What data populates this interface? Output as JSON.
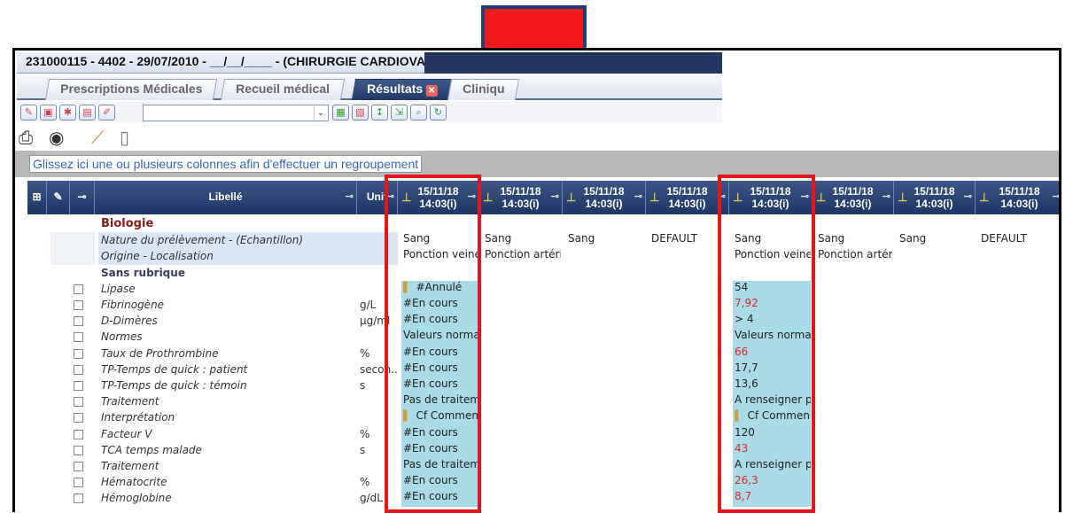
{
  "window": {
    "title": "231000115 - 4402 - 29/07/2010 - __/__/____ - (CHIRURGIE CARDIOVA"
  },
  "tabs": [
    {
      "label": "Prescriptions Médicales",
      "active": false
    },
    {
      "label": "Recueil médical",
      "active": false
    },
    {
      "label": "Résultats",
      "active": true
    },
    {
      "label": "Cliniqu",
      "active": false
    }
  ],
  "toolbar": {
    "combo_value": ""
  },
  "grouping_hint": "Glissez ici une ou plusieurs colonnes afin d'effectuer un regroupement",
  "headers": {
    "libelle": "Libellé",
    "unit": "Unit",
    "columns": [
      {
        "date": "15/11/18",
        "time": "14:03(i)"
      },
      {
        "date": "15/11/18",
        "time": "14:03(i)"
      },
      {
        "date": "15/11/18",
        "time": "14:03(i)"
      },
      {
        "date": "15/11/18",
        "time": "14:03(i)"
      },
      {
        "date": "15/11/18",
        "time": "14:03(i)"
      },
      {
        "date": "15/11/18",
        "time": "14:03(i)"
      },
      {
        "date": "15/11/18",
        "time": "14:03(i)"
      },
      {
        "date": "15/11/18",
        "time": "14:03(i)"
      }
    ]
  },
  "rows": [
    {
      "label": "Biologie",
      "unit": "",
      "type": "biol",
      "values": [
        "",
        "",
        "",
        "",
        "",
        "",
        "",
        ""
      ]
    },
    {
      "label": "Nature du prélèvement - (Echantillon)",
      "unit": "",
      "type": "blue",
      "values": [
        "Sang",
        "Sang",
        "Sang",
        "DEFAULT",
        "Sang",
        "Sang",
        "Sang",
        "DEFAULT"
      ]
    },
    {
      "label": "Origine - Localisation",
      "unit": "",
      "type": "blue",
      "values": [
        "Ponction veine...",
        "Ponction artéri...",
        "",
        "",
        "Ponction veine...",
        "Ponction artéri...",
        "",
        ""
      ]
    },
    {
      "label": "Sans rubrique",
      "unit": "",
      "type": "sect",
      "values": [
        "",
        "",
        "",
        "",
        "",
        "",
        "",
        ""
      ]
    },
    {
      "label": "Lipase",
      "unit": "",
      "type": "item",
      "values": [
        "#Annulé",
        "",
        "",
        "",
        "54",
        "",
        "",
        ""
      ],
      "pen": [
        true,
        false
      ]
    },
    {
      "label": "Fibrinogène",
      "unit": "g/L",
      "type": "item",
      "values": [
        "#En cours",
        "",
        "",
        "",
        "7,92",
        "",
        "",
        ""
      ],
      "red5": true
    },
    {
      "label": "D-Dimères",
      "unit": "µg/ml",
      "type": "item",
      "values": [
        "#En cours",
        "",
        "",
        "",
        "> 4",
        "",
        "",
        ""
      ]
    },
    {
      "label": "Normes",
      "unit": "",
      "type": "item",
      "values": [
        "Valeurs norma...",
        "",
        "",
        "",
        "Valeurs norma...",
        "",
        "",
        ""
      ]
    },
    {
      "label": "Taux de Prothrombine",
      "unit": "%",
      "type": "item",
      "values": [
        "#En cours",
        "",
        "",
        "",
        "66",
        "",
        "",
        ""
      ],
      "red5": true
    },
    {
      "label": "TP-Temps de quick : patient",
      "unit": "secon...",
      "type": "item",
      "values": [
        "#En cours",
        "",
        "",
        "",
        "17,7",
        "",
        "",
        ""
      ]
    },
    {
      "label": "TP-Temps de quick : témoin",
      "unit": "s",
      "type": "item",
      "values": [
        "#En cours",
        "",
        "",
        "",
        "13,6",
        "",
        "",
        ""
      ]
    },
    {
      "label": "Traitement",
      "unit": "",
      "type": "item",
      "values": [
        "Pas de traitem...",
        "",
        "",
        "",
        "A renseigner p...",
        "",
        "",
        ""
      ]
    },
    {
      "label": "Interprétation",
      "unit": "",
      "type": "item",
      "values": [
        "Cf Commen...",
        "",
        "",
        "",
        "Cf Commen...",
        "",
        "",
        ""
      ],
      "pen": [
        true,
        true
      ]
    },
    {
      "label": "Facteur V",
      "unit": "%",
      "type": "item",
      "values": [
        "#En cours",
        "",
        "",
        "",
        "120",
        "",
        "",
        ""
      ]
    },
    {
      "label": "TCA temps malade",
      "unit": "s",
      "type": "item",
      "values": [
        "#En cours",
        "",
        "",
        "",
        "43",
        "",
        "",
        ""
      ],
      "red5": true
    },
    {
      "label": "Traitement",
      "unit": "",
      "type": "item",
      "values": [
        "Pas de traitem...",
        "",
        "",
        "",
        "A renseigner p...",
        "",
        "",
        ""
      ]
    },
    {
      "label": "Hématocrite",
      "unit": "%",
      "type": "item",
      "values": [
        "#En cours",
        "",
        "",
        "",
        "26,3",
        "",
        "",
        ""
      ],
      "red5": true
    },
    {
      "label": "Hémoglobine",
      "unit": "g/dL",
      "type": "item",
      "values": [
        "#En cours",
        "",
        "",
        "",
        "8,7",
        "",
        "",
        ""
      ],
      "red5": true
    }
  ],
  "colors": {
    "annotation_red": "#e5151b",
    "header_navy": "#23365f",
    "cell_highlight": "#a9dbe6",
    "abnormal_value": "#e0242c"
  },
  "icons": [
    "printer-icon",
    "eye-icon",
    "chart-icon",
    "clipboard-icon",
    "pencil-icon",
    "pin-icon",
    "filter-icon",
    "checkbox-icon"
  ]
}
